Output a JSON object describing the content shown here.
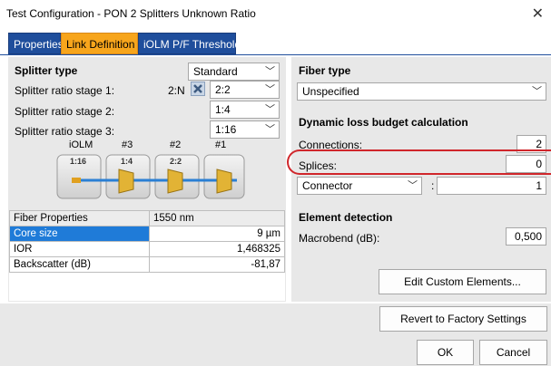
{
  "window": {
    "title": "Test Configuration - PON 2 Splitters Unknown Ratio"
  },
  "tabs": [
    "Properties",
    "Link Definition",
    "iOLM P/F Thresholds"
  ],
  "splitter": {
    "heading": "Splitter type",
    "type_value": "Standard",
    "stage1_label": "Splitter ratio stage 1:",
    "stage1_prefix": "2:N",
    "stage1_value": "2:2",
    "stage2_label": "Splitter ratio stage 2:",
    "stage2_value": "1:4",
    "stage3_label": "Splitter ratio stage 3:",
    "stage3_value": "1:16"
  },
  "diagram": {
    "labels": [
      "iOLM",
      "#3",
      "#2",
      "#1"
    ],
    "splitters": [
      "1:16",
      "1:4",
      "2:2"
    ]
  },
  "fiber_props": {
    "headers": [
      "Fiber Properties",
      "1550 nm"
    ],
    "rows": [
      {
        "name": "Core size",
        "value": "9 µm"
      },
      {
        "name": "IOR",
        "value": "1,468325"
      },
      {
        "name": "Backscatter (dB)",
        "value": "-81,87"
      }
    ]
  },
  "fiber_type": {
    "heading": "Fiber type",
    "value": "Unspecified"
  },
  "loss_budget": {
    "heading": "Dynamic loss budget calculation",
    "connections_label": "Connections:",
    "connections_value": "2",
    "splices_label": "Splices:",
    "splices_value": "0",
    "element_value": "Connector",
    "element_sep": ":",
    "element_count": "1"
  },
  "element_detection": {
    "heading": "Element detection",
    "macrobend_label": "Macrobend (dB):",
    "macrobend_value": "0,500"
  },
  "buttons": {
    "edit_custom": "Edit Custom Elements...",
    "revert": "Revert to Factory Settings",
    "ok": "OK",
    "cancel": "Cancel"
  },
  "colors": {
    "tab_blue": "#1f4e9c",
    "tab_active": "#f7a51c",
    "highlight_red": "#d0262b",
    "selection_blue": "#1f7bd8"
  }
}
